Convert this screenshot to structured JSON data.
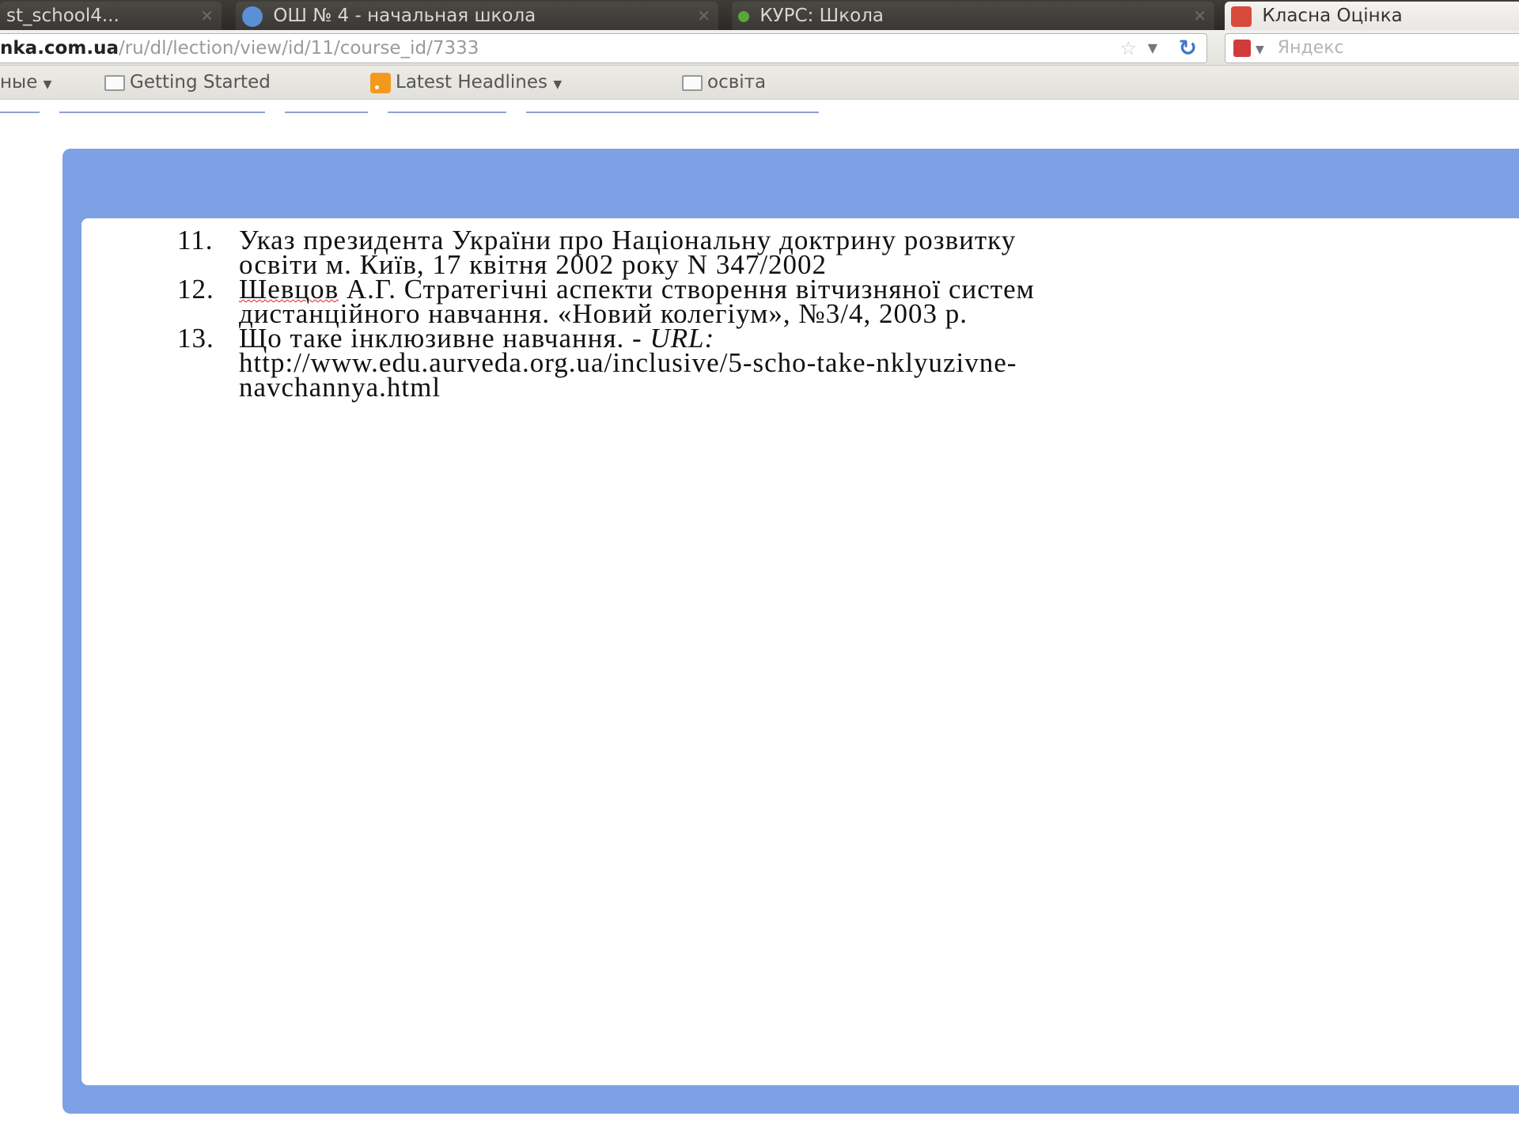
{
  "tabs": [
    {
      "label": "st_school4...",
      "active": false
    },
    {
      "label": "ОШ № 4 - начальная школа",
      "active": false
    },
    {
      "label": "КУРС: Школа",
      "active": false
    },
    {
      "label": "Класна Оцінка",
      "active": true
    }
  ],
  "address_bar": {
    "domain": "nka.com.ua",
    "path": "/ru/dl/lection/view/id/11/course_id/7333"
  },
  "search_bar": {
    "placeholder": "Яндекс"
  },
  "bookmarks": {
    "truncated_label": "ные",
    "items": [
      {
        "label": "Getting Started"
      },
      {
        "label": "Latest Headlines"
      },
      {
        "label": "освіта"
      }
    ]
  },
  "references": [
    {
      "number": "11.",
      "line1": "Указ президента України про Національну доктрину розвитку",
      "line2": "освіти м. Київ, 17 квітня 2002 року N 347/2002"
    },
    {
      "number": "12.",
      "author": "Шевцов",
      "line1_rest": " А.Г. Стратегічні аспекти створення вітчизняної систем",
      "line2": "дистанційного навчання. «Новий колегіум», №3/4, 2003 р."
    },
    {
      "number": "13.",
      "line1": "Що таке інклюзивне навчання.  - ",
      "url_label": "URL:",
      "line2": "http://www.edu.aurveda.org.ua/inclusive/5-scho-take-nklyuzivne-",
      "line3": "navchannya.html"
    }
  ],
  "colors": {
    "panel_border": "#7ea1e5",
    "tab_bar": "#3a3834",
    "reload_icon": "#3c78c8",
    "rss_icon": "#f39a1d"
  }
}
